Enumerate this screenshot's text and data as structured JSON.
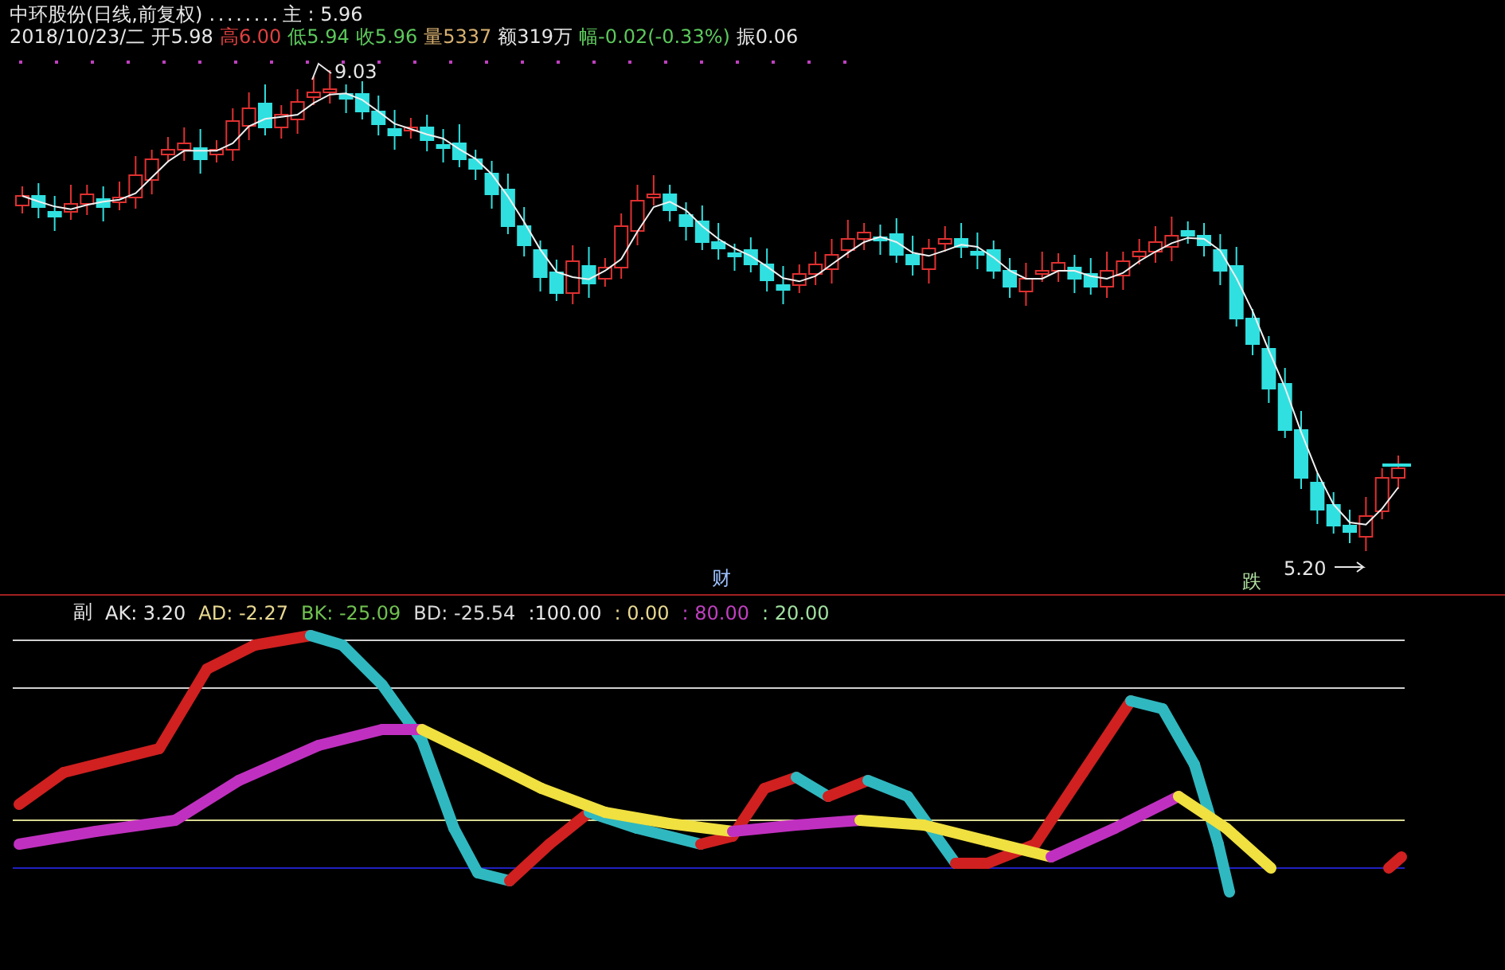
{
  "header": {
    "title": "中环股份(日线,前复权)",
    "dots": ". . . . . . . .",
    "main_label": "主 : 5.96"
  },
  "quote": [
    {
      "label": "2018/10/23/二",
      "color": "#e6e6e6"
    },
    {
      "label": "开5.98",
      "color": "#e6e6e6"
    },
    {
      "label": "高6.00",
      "color": "#e04040"
    },
    {
      "label": "低5.94",
      "color": "#5cc85c"
    },
    {
      "label": "收5.96",
      "color": "#5cc85c"
    },
    {
      "label": "量5337",
      "color": "#d8b070"
    },
    {
      "label": "额319万",
      "color": "#e6e6e6"
    },
    {
      "label": "幅-0.02(-0.33%)",
      "color": "#5cc85c"
    },
    {
      "label": "振0.06",
      "color": "#e6e6e6"
    }
  ],
  "price_marks": [
    {
      "kind": "high",
      "label": "9.03"
    },
    {
      "kind": "low",
      "label": "5.20"
    }
  ],
  "event_marks": [
    {
      "label": "财",
      "color": "#9cc0ff"
    },
    {
      "label": "跌",
      "color": "#b0e0a0"
    }
  ],
  "indicator": {
    "name": "副",
    "values": [
      {
        "label": "AK: 3.20",
        "color": "#e6e6e6"
      },
      {
        "label": "AD: -2.27",
        "color": "#e8d890"
      },
      {
        "label": "BK: -25.09",
        "color": "#70c050"
      },
      {
        "label": "BD: -25.54",
        "color": "#d8d8d8"
      },
      {
        "label": ":100.00",
        "color": "#e6e6e6"
      },
      {
        "label": ": 0.00",
        "color": "#e8d890"
      },
      {
        "label": ": 80.00",
        "color": "#c040c0"
      },
      {
        "label": ": 20.00",
        "color": "#a0e0a0"
      }
    ]
  }
}
